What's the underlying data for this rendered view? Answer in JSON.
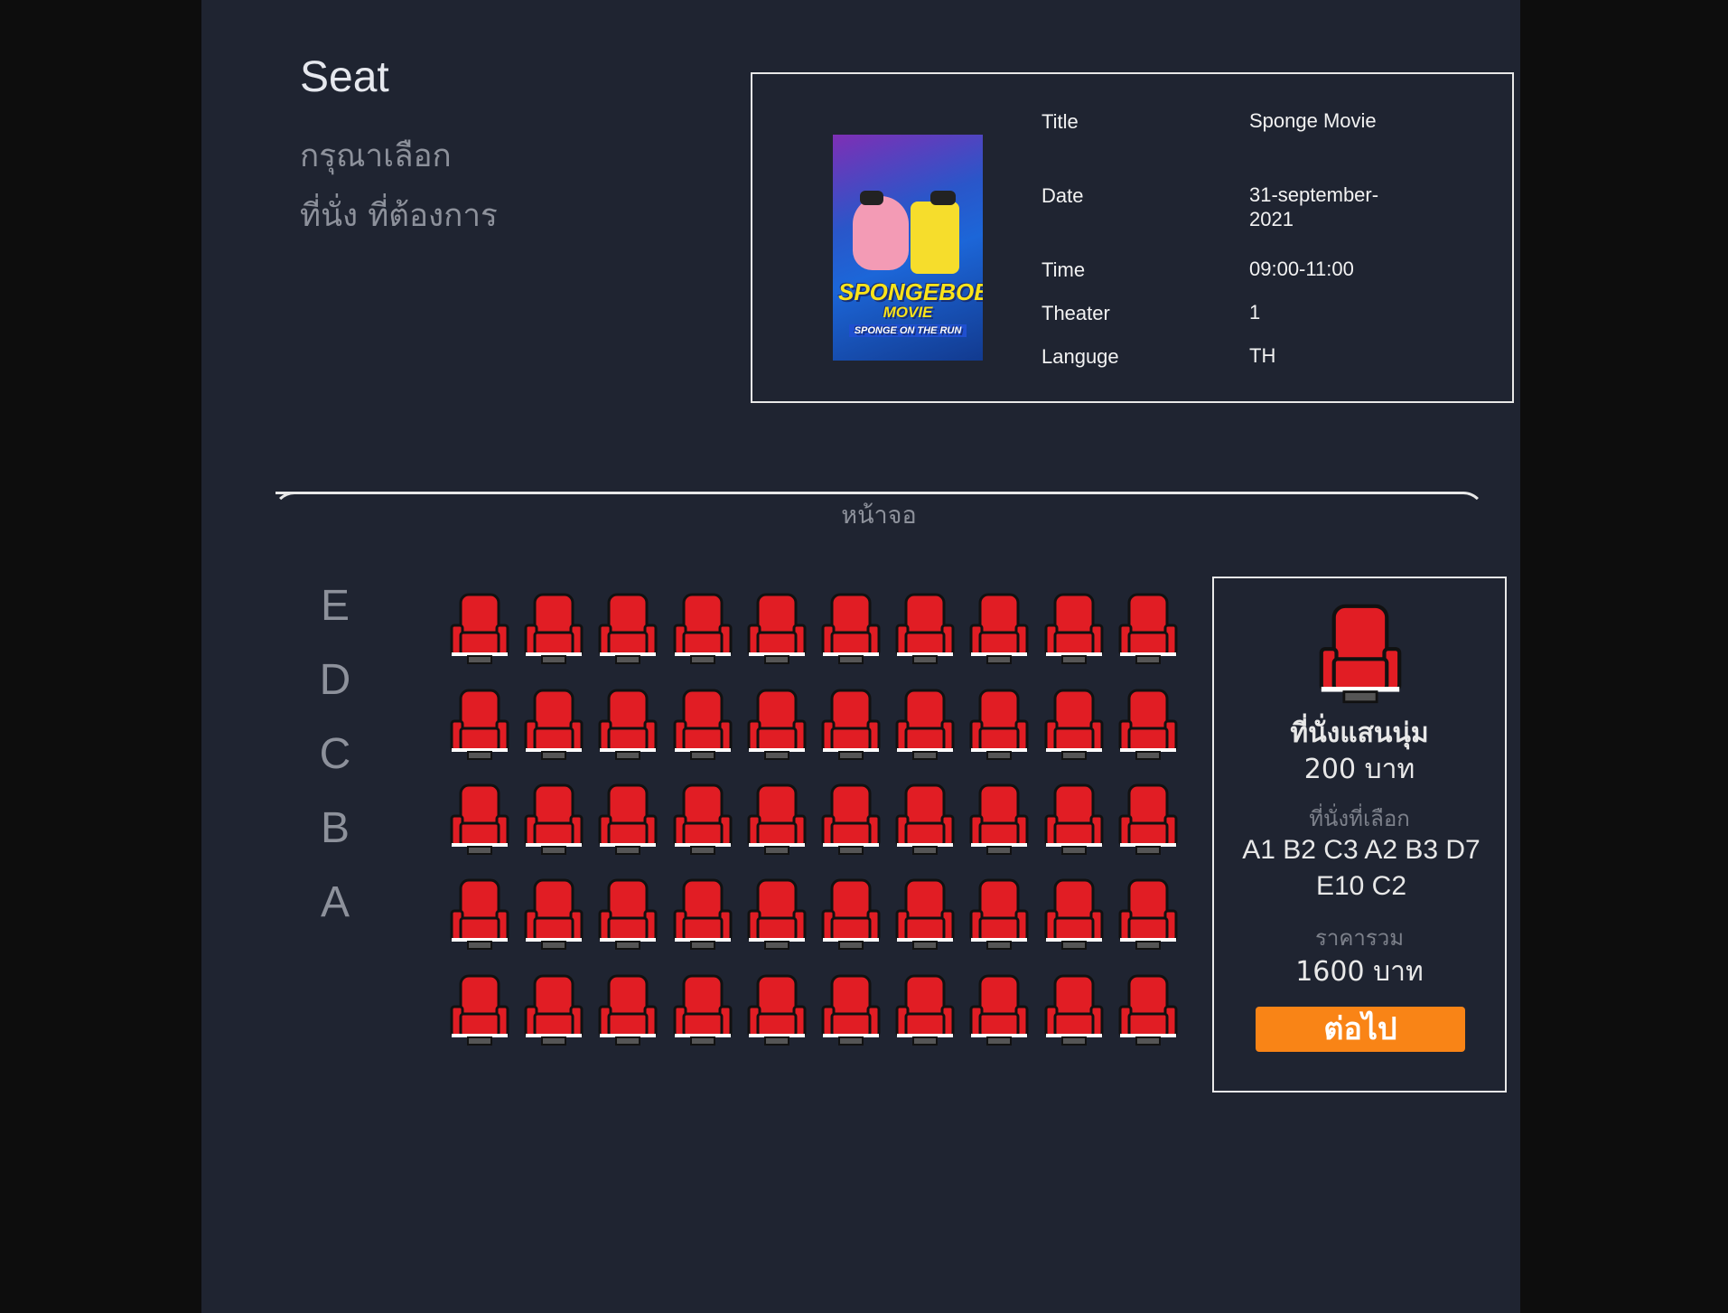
{
  "header": {
    "title": "Seat",
    "subtitle_line1": "กรุณาเลือก",
    "subtitle_line2": "ที่นั่ง ที่ต้องการ"
  },
  "movie_info": {
    "poster_alt": "THE SPONGEBOB MOVIE SPONGE ON THE RUN",
    "poster_line1": "SPONGEBOB",
    "poster_line2": "MOVIE",
    "poster_line3": "SPONGE ON THE RUN",
    "rows": [
      {
        "label": "Title",
        "value": "Sponge Movie"
      },
      {
        "label": "Date",
        "value": "31-september-2021"
      },
      {
        "label": "Time",
        "value": "09:00-11:00"
      },
      {
        "label": "Theater",
        "value": "1"
      },
      {
        "label": "Languge",
        "value": "TH"
      }
    ]
  },
  "screen": {
    "label": "หน้าจอ"
  },
  "seat_map": {
    "row_labels": [
      "E",
      "D",
      "C",
      "B",
      "A"
    ],
    "seats_per_row": 10,
    "seat_color": "#e11d24"
  },
  "summary": {
    "seat_type": "ที่นั่งแสนนุ่ม",
    "seat_price": "200 บาท",
    "selected_label": "ที่นั่งที่เลือก",
    "selected_seats": "A1 B2 C3 A2 B3 D7 E10 C2",
    "total_label": "ราคารวม",
    "total_price": "1600 บาท",
    "next_button": "ต่อไป",
    "button_color": "#f98416"
  }
}
